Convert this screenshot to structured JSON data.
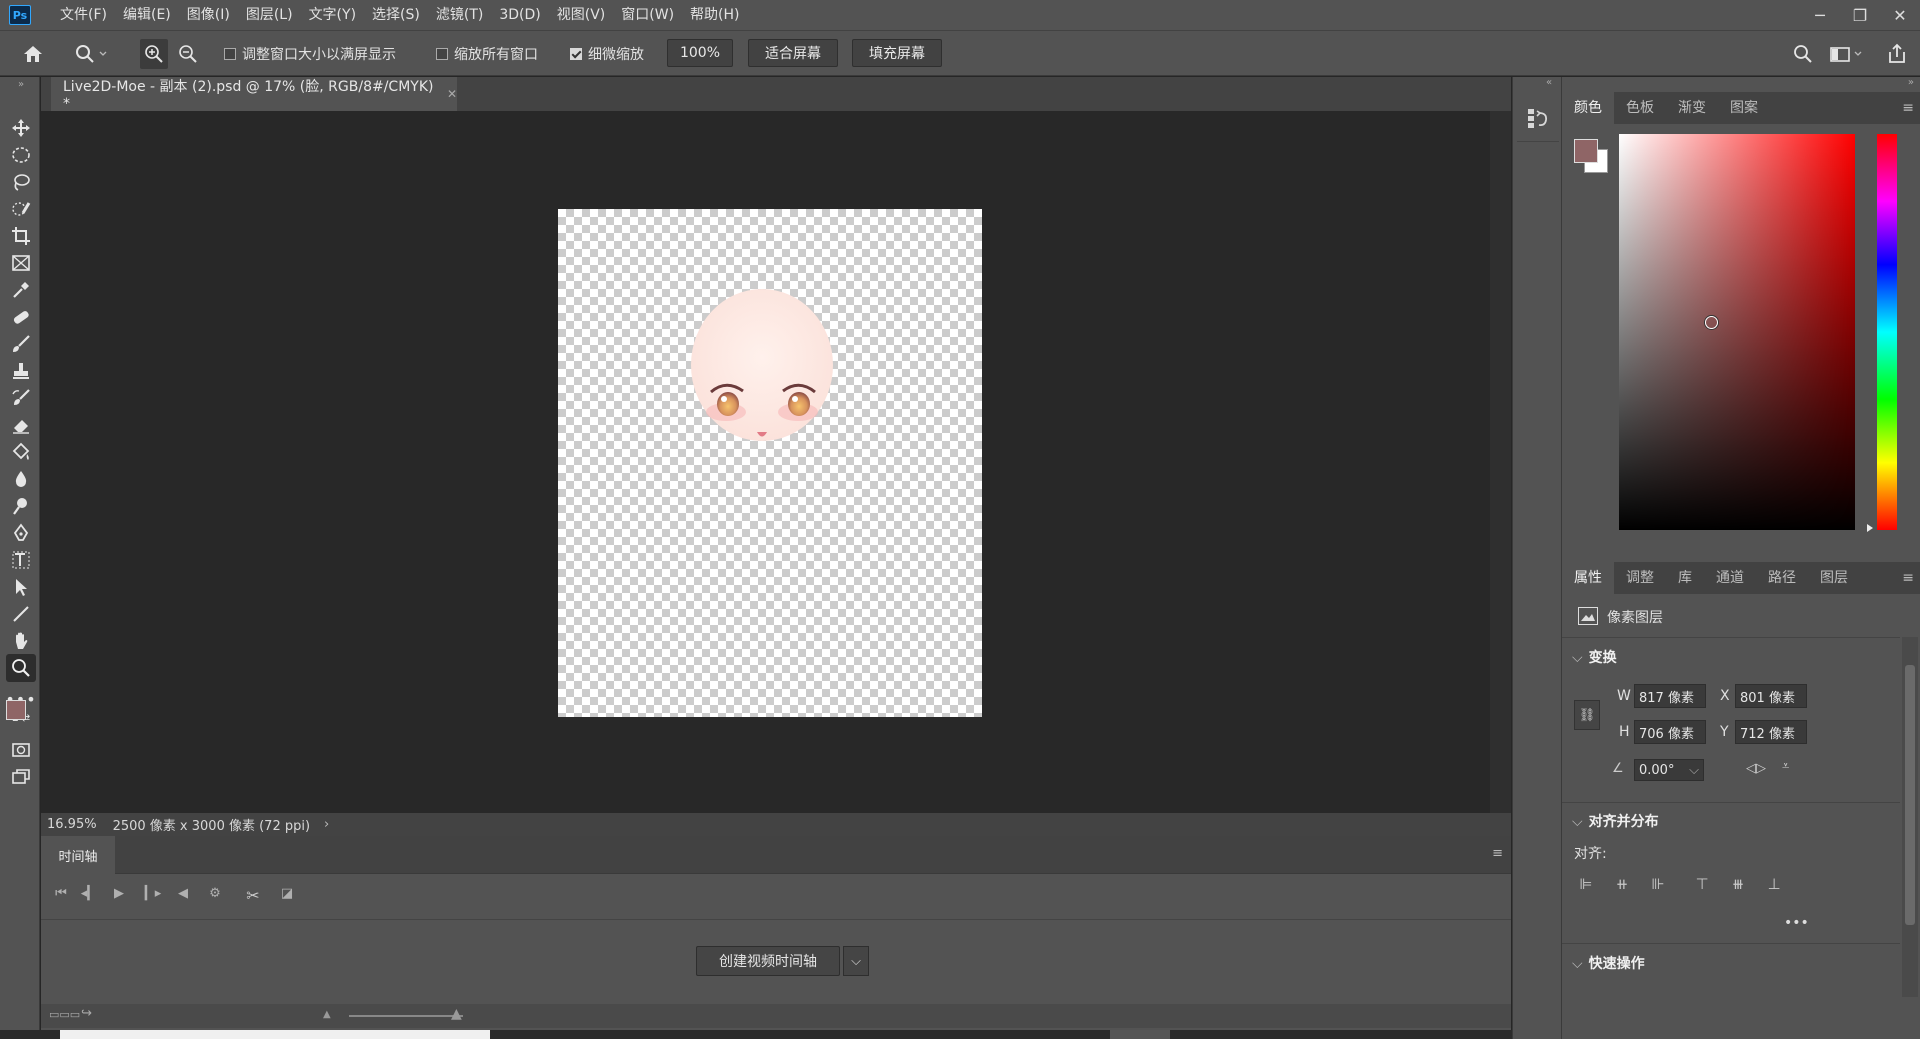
{
  "app": {
    "logo": "Ps"
  },
  "menu": [
    "文件(F)",
    "编辑(E)",
    "图像(I)",
    "图层(L)",
    "文字(Y)",
    "选择(S)",
    "滤镜(T)",
    "3D(D)",
    "视图(V)",
    "窗口(W)",
    "帮助(H)"
  ],
  "options": {
    "resize_windows": "调整窗口大小以满屏显示",
    "zoom_all_windows": "缩放所有窗口",
    "scrubby_zoom": "细微缩放",
    "zoom_value": "100%",
    "fit_screen": "适合屏幕",
    "fill_screen": "填充屏幕"
  },
  "document": {
    "tab_title": "Live2D-Moe - 副本 (2).psd @ 17% (脸, RGB/8#/CMYK) *",
    "zoom": "16.95%",
    "size_info": "2500 像素 x 3000 像素 (72 ppi)"
  },
  "timeline": {
    "tab": "时间轴",
    "create_button": "创建视频时间轴"
  },
  "color_panel": {
    "tabs": [
      "颜色",
      "色板",
      "渐变",
      "图案"
    ],
    "foreground": "#8f6566",
    "background": "#ffffff"
  },
  "properties_panel": {
    "tabs": [
      "属性",
      "调整",
      "库",
      "通道",
      "路径",
      "图层"
    ],
    "layer_type": "像素图层",
    "transform_title": "变换",
    "w_label": "W",
    "w_value": "817 像素",
    "h_label": "H",
    "h_value": "706 像素",
    "x_label": "X",
    "x_value": "801 像素",
    "y_label": "Y",
    "y_value": "712 像素",
    "angle_value": "0.00°",
    "align_title": "对齐并分布",
    "align_label": "对齐:",
    "quick_actions_title": "快速操作"
  }
}
